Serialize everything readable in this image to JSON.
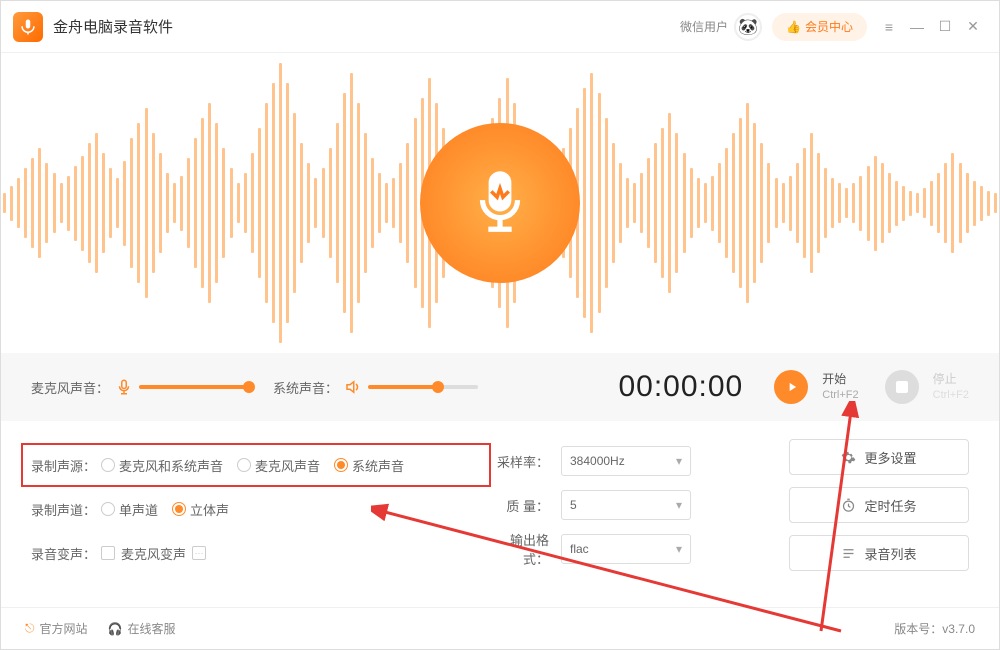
{
  "titlebar": {
    "app_title": "金舟电脑录音软件",
    "wx_user_label": "微信用户",
    "vip_label": "会员中心",
    "avatar_emoji": "🐼"
  },
  "controls": {
    "mic_label": "麦克风声音：",
    "sys_label": "系统声音：",
    "timer": "00:00:00",
    "start_label": "开始",
    "start_shortcut": "Ctrl+F2",
    "stop_label": "停止",
    "stop_shortcut": "Ctrl+F2"
  },
  "settings": {
    "source_label": "录制声源：",
    "source_options": [
      "麦克风和系统声音",
      "麦克风声音",
      "系统声音"
    ],
    "source_selected": 2,
    "channel_label": "录制声道：",
    "channel_options": [
      "单声道",
      "立体声"
    ],
    "channel_selected": 1,
    "voice_change_label": "录音变声：",
    "voice_change_option": "麦克风变声",
    "sample_rate_label": "采样率：",
    "sample_rate_value": "384000Hz",
    "quality_label": "质 量：",
    "quality_value": "5",
    "format_label": "输出格式：",
    "format_value": "flac"
  },
  "side_buttons": {
    "more": "更多设置",
    "timer_task": "定时任务",
    "list": "录音列表"
  },
  "footer": {
    "official": "官方网站",
    "support": "在线客服",
    "version_label": "版本号：",
    "version": "v3.7.0"
  }
}
